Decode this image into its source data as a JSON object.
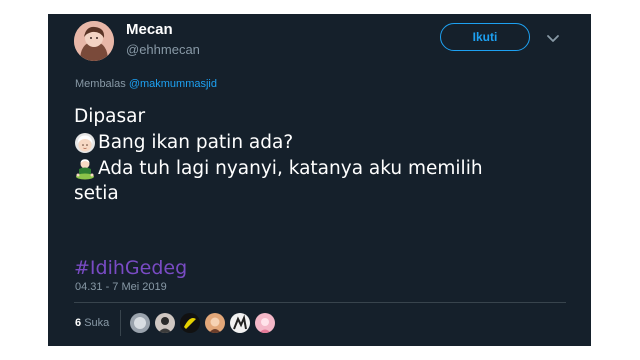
{
  "user": {
    "name": "Mecan",
    "handle": "@ehhmecan"
  },
  "follow_button": {
    "label": "Ikuti"
  },
  "reply": {
    "prefix": "Membalas",
    "mention": "@makmummasjid"
  },
  "tweet": {
    "line1": "Dipasar",
    "line2": "Bang ikan patin ada?",
    "line3": "Ada tuh lagi nyanyi, katanya aku memilih",
    "line4": "setia",
    "hashtag": "#IdihGedeg"
  },
  "timestamp": "04.31 - 7 Mei 2019",
  "likes": {
    "count": "6",
    "label": "Suka"
  },
  "icons": {
    "caret": "chevron-down-icon",
    "emoji1": "old-woman-emoji-icon",
    "emoji2": "man-in-lotus-position-emoji-icon"
  },
  "colors": {
    "background": "#15202b",
    "accent": "#1da1f2",
    "hashtag": "#794bc4",
    "secondary_text": "#8899a6"
  }
}
